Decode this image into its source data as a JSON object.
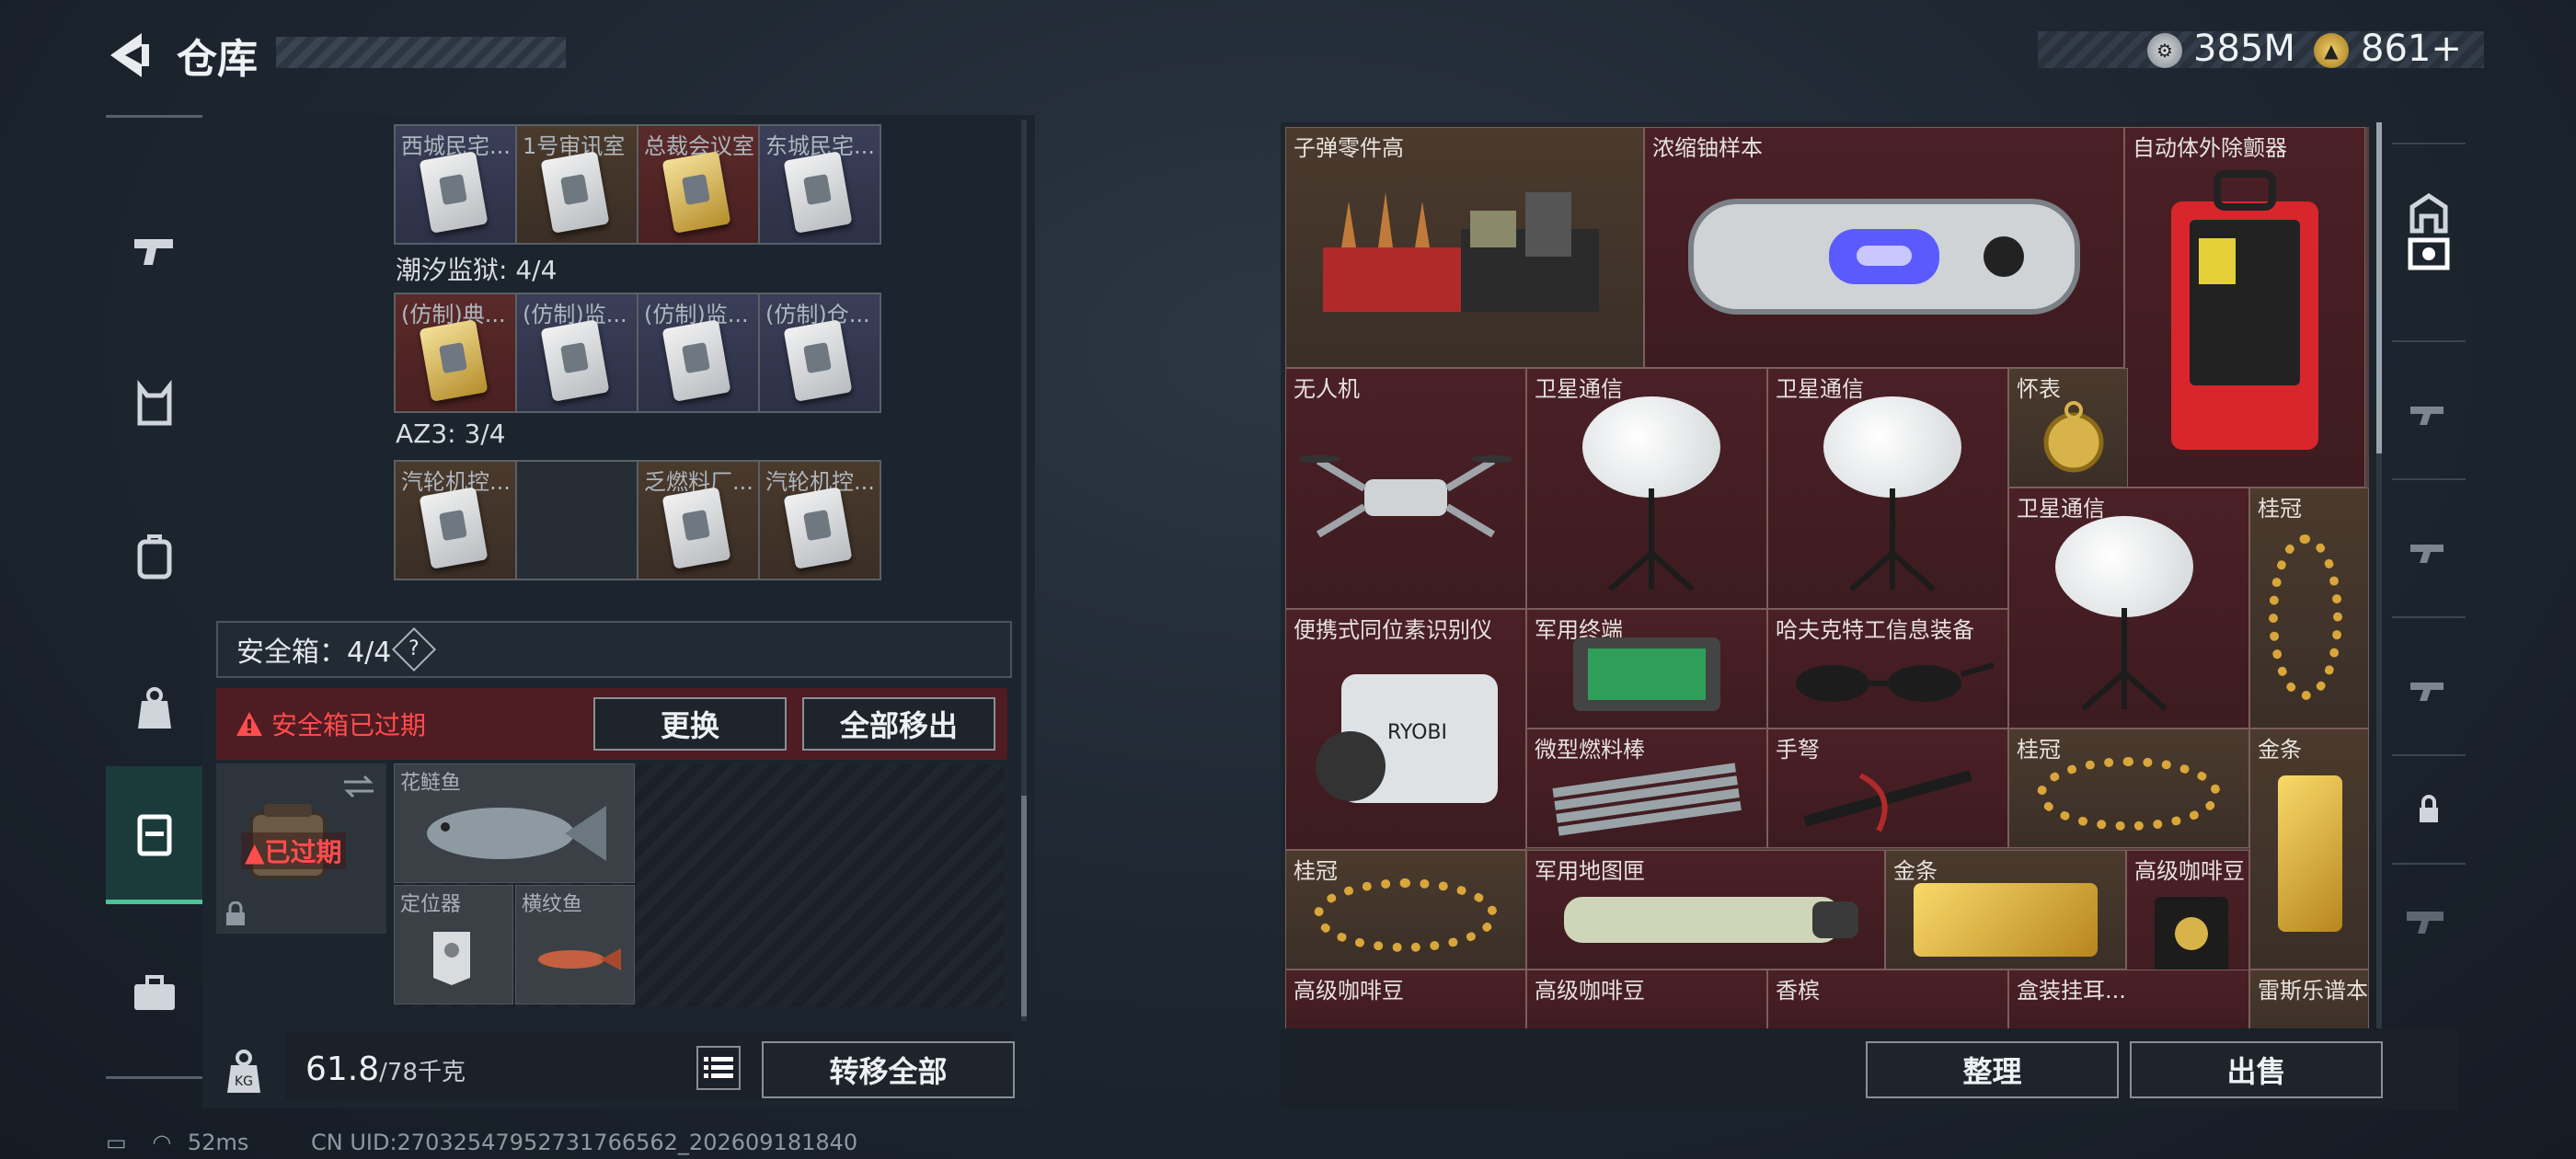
{
  "header": {
    "title": "仓库"
  },
  "currency": [
    {
      "icon": "silver-coin-icon",
      "value": "385M"
    },
    {
      "icon": "gold-coin-icon",
      "value": "861+"
    }
  ],
  "stash": {
    "group1": [
      "西城民宅...",
      "1号审讯室",
      "总裁会议室",
      "东城民宅..."
    ],
    "section2": "潮汐监狱: 4/4",
    "group2": [
      "(仿制)典...",
      "(仿制)监...",
      "(仿制)监...",
      "(仿制)仓..."
    ],
    "section3": "AZ3: 3/4",
    "group3": [
      "汽轮机控...",
      "",
      "乏燃料厂...",
      "汽轮机控..."
    ]
  },
  "safebox": {
    "title": "安全箱：4/4",
    "help": "?",
    "warning": "安全箱已过期",
    "replace": "更换",
    "move_all_out": "全部移出",
    "expired": "已过期",
    "items": [
      "花鲢鱼",
      "定位器",
      "横纹鱼"
    ]
  },
  "footer": {
    "weight": "61.8",
    "weight_max": "/78千克",
    "transfer_all": "转移全部"
  },
  "inventory": {
    "labels": [
      "子弹零件高",
      "浓缩铀样本",
      "自动体外除颤器",
      "无人机",
      "卫星通信",
      "卫星通信",
      "怀表",
      "卫星通信",
      "桂冠",
      "便携式同位素识别仪",
      "军用终端",
      "哈夫克特工信息装备",
      "微型燃料棒",
      "手弩",
      "桂冠",
      "金条",
      "桂冠",
      "军用地图匣",
      "金条",
      "高级咖啡豆",
      "高级咖啡豆",
      "高级咖啡豆",
      "香槟",
      "盒装挂耳...",
      "雷斯乐谱本"
    ]
  },
  "actions": {
    "sort": "整理",
    "sell": "出售"
  },
  "status": {
    "ping": "52ms",
    "uid": "CN UID:27032547952731766562_202609181840"
  }
}
